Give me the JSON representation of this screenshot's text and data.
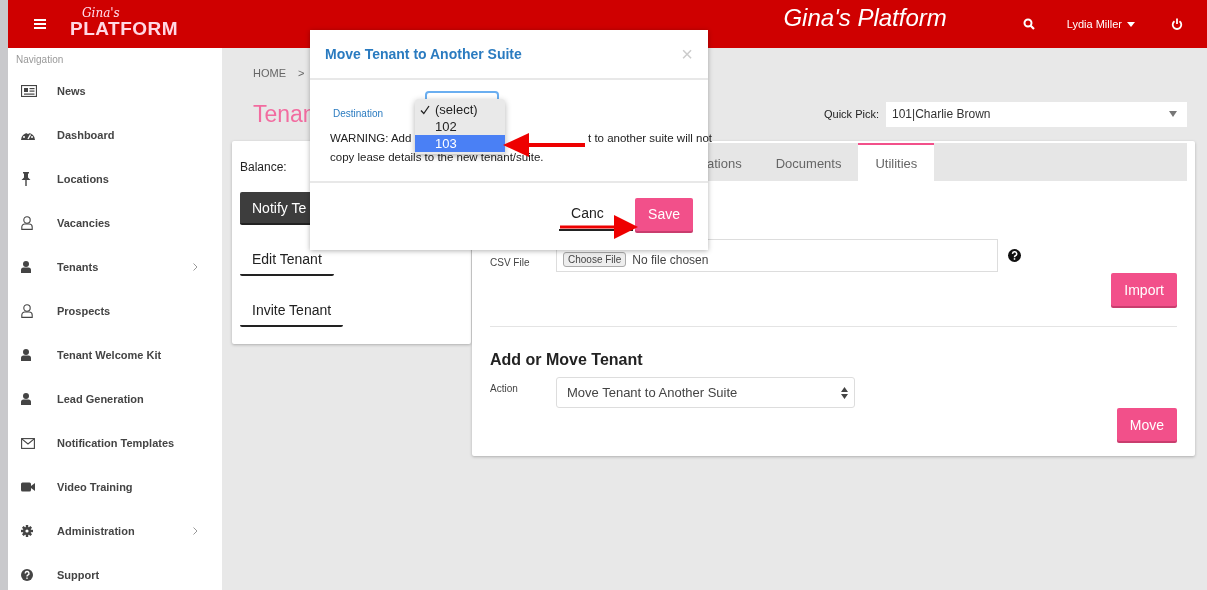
{
  "header": {
    "logo_script": "Gina's",
    "logo_word": "PLATFORM",
    "title": "Gina's Platform",
    "user": "Lydia Miller"
  },
  "sidebar": {
    "heading": "Navigation",
    "items": [
      {
        "label": "News",
        "kind": "news",
        "has_submenu": false
      },
      {
        "label": "Dashboard",
        "kind": "gauge",
        "has_submenu": false
      },
      {
        "label": "Locations",
        "kind": "pin",
        "has_submenu": false
      },
      {
        "label": "Vacancies",
        "kind": "outline",
        "has_submenu": false
      },
      {
        "label": "Tenants",
        "kind": "solid",
        "has_submenu": true
      },
      {
        "label": "Prospects",
        "kind": "outline",
        "has_submenu": false
      },
      {
        "label": "Tenant Welcome Kit",
        "kind": "solid",
        "has_submenu": false
      },
      {
        "label": "Lead Generation",
        "kind": "solid",
        "has_submenu": false
      },
      {
        "label": "Notification Templates",
        "kind": "mail",
        "has_submenu": false
      },
      {
        "label": "Video Training",
        "kind": "video",
        "has_submenu": false
      },
      {
        "label": "Administration",
        "kind": "gear",
        "has_submenu": true
      },
      {
        "label": "Support",
        "kind": "help",
        "has_submenu": false
      }
    ]
  },
  "breadcrumb": {
    "items": [
      "HOME"
    ],
    "separator": ">"
  },
  "page_title": "Tenan",
  "quick_pick": {
    "label": "Quick Pick:",
    "value": "101|Charlie Brown"
  },
  "tenant_card": {
    "balance_label": "Balance:",
    "buttons": [
      {
        "label": "Notify Te",
        "kind": "dark"
      },
      {
        "label": "Edit Tenant",
        "kind": "outline"
      },
      {
        "label": "Invite Tenant",
        "kind": "outline"
      }
    ]
  },
  "tabs": [
    {
      "label": "ations",
      "selected": false
    },
    {
      "label": "Documents",
      "selected": false
    },
    {
      "label": "Utilities",
      "selected": true
    }
  ],
  "import": {
    "file_label": "CSV File",
    "choose_button": "Choose File",
    "file_status": "No file chosen",
    "button": "Import"
  },
  "move_section": {
    "heading": "Add or Move Tenant",
    "action_label": "Action",
    "action_value": "Move Tenant to Another Suite",
    "button": "Move"
  },
  "modal": {
    "title": "Move Tenant to Another Suite",
    "close": "×",
    "destination_label": "Destination",
    "options": [
      {
        "label": "(select)",
        "checked": true,
        "selected": false
      },
      {
        "label": "102",
        "checked": false,
        "selected": false
      },
      {
        "label": "103",
        "checked": false,
        "selected": true
      }
    ],
    "warning_start": "WARNING: Add",
    "warning_end": "t to another suite will not",
    "warning_line_2": "copy lease details to the new tenant/suite.",
    "cancel": "Canc",
    "save": "Save"
  }
}
